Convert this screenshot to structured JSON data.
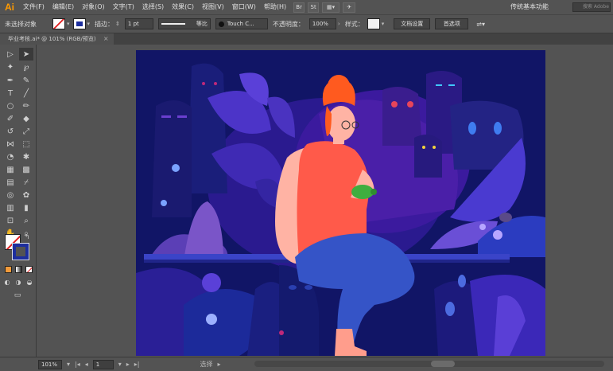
{
  "app": {
    "logo": "Ai"
  },
  "menu": {
    "items": [
      "文件(F)",
      "编辑(E)",
      "对象(O)",
      "文字(T)",
      "选择(S)",
      "效果(C)",
      "视图(V)",
      "窗口(W)",
      "帮助(H)"
    ],
    "br_button": "Br",
    "st_button": "St",
    "workspace": "传统基本功能",
    "search_placeholder": "搜索 Adobe"
  },
  "control": {
    "selection": "未选择对象",
    "stroke_label": "描边：",
    "stroke_value": "1 pt",
    "brush_label": "等比",
    "brush_value": "Touch C...",
    "opacity_label": "不透明度：",
    "opacity_value": "100%",
    "style_label": "样式：",
    "doc_setup": "文档设置",
    "preferences": "首选项"
  },
  "tab": {
    "title": "毕业考核.ai* @ 101% (RGB/预览)",
    "close": "×"
  },
  "status": {
    "zoom": "101%",
    "page": "1",
    "tool_label": "选择"
  },
  "colors": {
    "ui_bg": "#535353",
    "artboard_bg": "#111566",
    "accent_orange": "#ff9a00",
    "hair": "#ff5a1f",
    "shirt": "#ff5a4a",
    "jeans": "#3554c7",
    "skin": "#ffb3a4"
  },
  "tools": {
    "icons": [
      "selection-tool",
      "direct-selection-tool",
      "magic-wand-tool",
      "lasso-tool",
      "pen-tool",
      "curvature-tool",
      "type-tool",
      "line-tool",
      "ellipse-tool",
      "paintbrush-tool",
      "pencil-tool",
      "eraser-tool",
      "rotate-tool",
      "scale-tool",
      "width-tool",
      "free-transform-tool",
      "shape-builder-tool",
      "live-paint-tool",
      "perspective-tool",
      "mesh-tool",
      "gradient-tool",
      "eyedropper-tool",
      "blend-tool",
      "symbol-sprayer-tool",
      "graph-tool",
      "artboard-tool",
      "slice-tool",
      "hand-tool",
      "zoom-tool"
    ]
  }
}
